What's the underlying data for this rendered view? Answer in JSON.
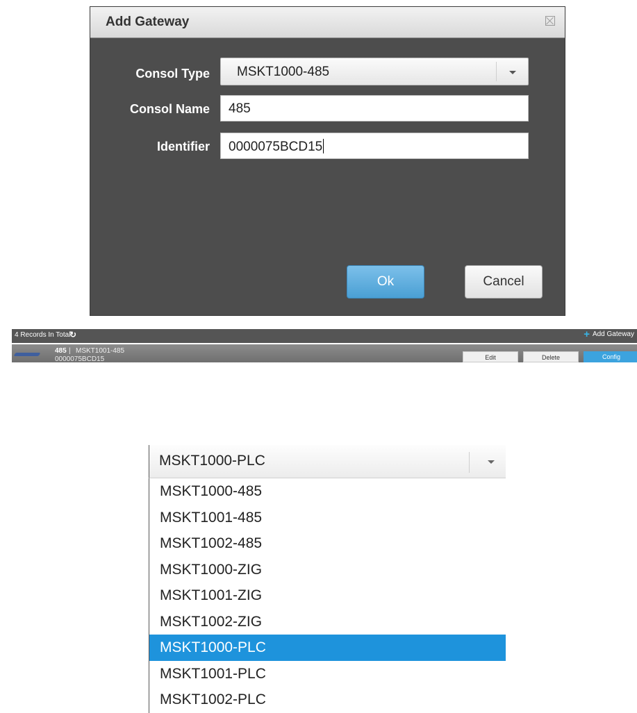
{
  "dialog": {
    "title": "Add Gateway",
    "close_icon": "close-icon",
    "fields": {
      "consol_type_label": "Consol Type",
      "consol_type_value": "MSKT1000-485",
      "consol_name_label": "Consol Name",
      "consol_name_value": "485",
      "identifier_label": "Identifier",
      "identifier_value": "0000075BCD15"
    },
    "ok_label": "Ok",
    "cancel_label": "Cancel",
    "colors": {
      "body": "#4d4d4d",
      "ok": "#4a9fd4"
    }
  },
  "records": {
    "count_label": "4 Records In Total",
    "refresh_icon": "refresh-icon",
    "add_label": "Add Gateway",
    "add_icon": "plus-icon"
  },
  "gateway_row": {
    "name": "485",
    "separator": "|",
    "type": "MSKT1001-485",
    "identifier": "0000075BCD15",
    "edit_label": "Edit",
    "delete_label": "Delete",
    "config_label": "Config",
    "colors": {
      "config": "#3ca3de"
    }
  },
  "dropdown": {
    "current_value": "MSKT1000-PLC",
    "options": [
      "MSKT1000-485",
      "MSKT1001-485",
      "MSKT1002-485",
      "MSKT1000-ZIG",
      "MSKT1001-ZIG",
      "MSKT1002-ZIG",
      "MSKT1000-PLC",
      "MSKT1001-PLC",
      "MSKT1002-PLC"
    ],
    "selected_index": 6,
    "colors": {
      "highlight": "#1e93dc"
    }
  }
}
